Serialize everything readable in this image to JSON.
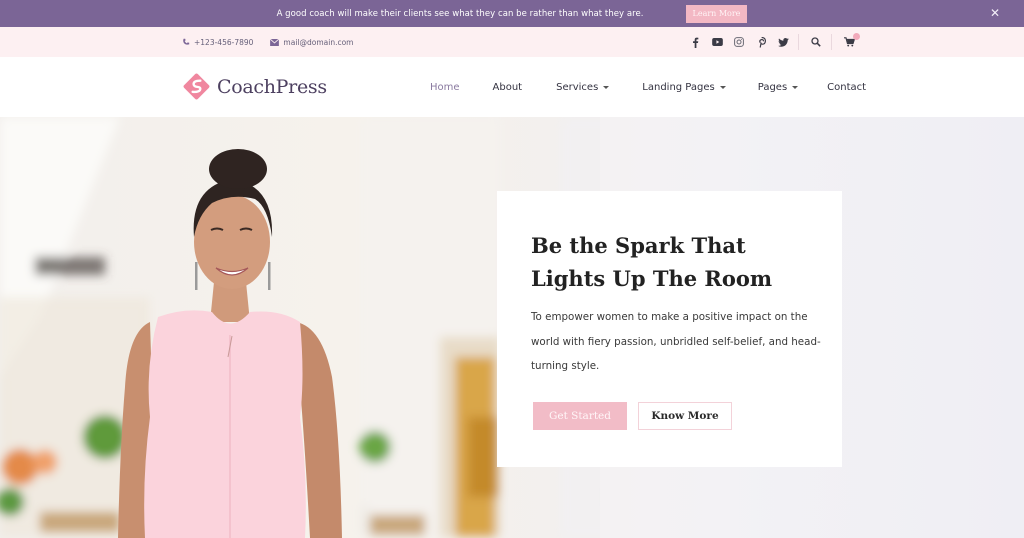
{
  "notice": {
    "text": "A good coach will make their clients see what they can be rather than what they are.",
    "button_label": "Learn More",
    "close_icon": "close-icon"
  },
  "topbar": {
    "phone": "+123-456-7890",
    "email": "mail@domain.com",
    "social_icons": [
      "facebook-icon",
      "youtube-icon",
      "instagram-icon",
      "pinterest-icon",
      "twitter-icon"
    ],
    "search_icon": "search-icon",
    "cart_icon": "cart-icon"
  },
  "header": {
    "logo_text": "CoachPress",
    "nav": [
      {
        "label": "Home",
        "active": true,
        "dropdown": false
      },
      {
        "label": "About",
        "active": false,
        "dropdown": false
      },
      {
        "label": "Services",
        "active": false,
        "dropdown": true
      },
      {
        "label": "Landing Pages",
        "active": false,
        "dropdown": true
      },
      {
        "label": "Pages",
        "active": false,
        "dropdown": true
      },
      {
        "label": "Contact",
        "active": false,
        "dropdown": false
      }
    ]
  },
  "hero": {
    "title": "Be the Spark That Lights Up The Room",
    "description": "To empower women to make a positive impact on the world with fiery passion, unbridled self-belief, and head-turning style.",
    "primary_button": "Get Started",
    "secondary_button": "Know More"
  },
  "colors": {
    "notice_bg": "#7b6596",
    "accent_pink": "#f2bcc7",
    "topbar_bg": "#fdf0f2",
    "logo_text": "#4d4060",
    "nav_active": "#8a7aa0"
  }
}
